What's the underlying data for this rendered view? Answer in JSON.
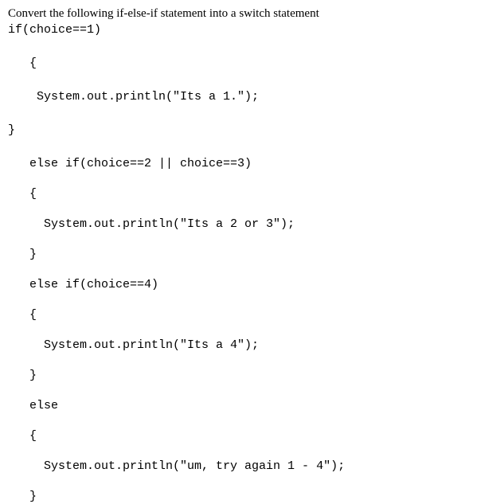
{
  "instruction": "Convert the following if-else-if statement into a switch statement",
  "lines": {
    "l1": "if(choice==1)",
    "l2": "   {",
    "l3": "    System.out.println(\"Its a 1.\");",
    "l4": "}",
    "l5": "   else if(choice==2 || choice==3)",
    "l6": "   {",
    "l7": "     System.out.println(\"Its a 2 or 3\");",
    "l8": "   }",
    "l9": "   else if(choice==4)",
    "l10": "   {",
    "l11": "     System.out.println(\"Its a 4\");",
    "l12": "   }",
    "l13": "   else",
    "l14": "   {",
    "l15": "     System.out.println(\"um, try again 1 - 4\");",
    "l16": "   }"
  }
}
